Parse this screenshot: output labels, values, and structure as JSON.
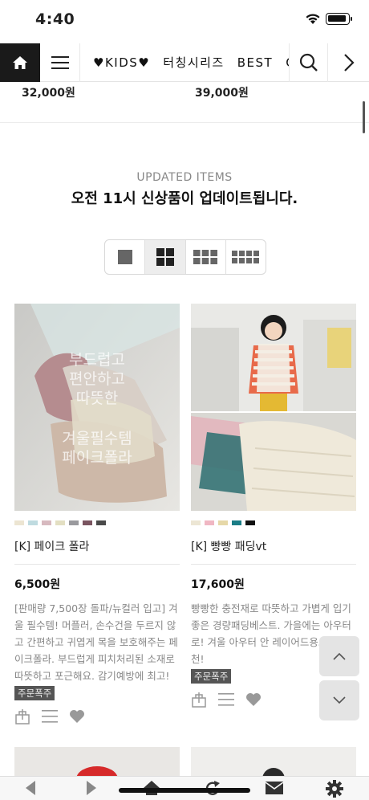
{
  "status": {
    "time": "4:40"
  },
  "nav": {
    "categories": [
      "♥KIDS♥",
      "터칭시리즈",
      "BEST",
      "C"
    ]
  },
  "top_prices": [
    "32,000원",
    "39,000원"
  ],
  "section": {
    "subtitle": "UPDATED ITEMS",
    "title": "오전 11시 신상품이 업데이트됩니다."
  },
  "products": [
    {
      "name": "[K] 페이크 폴라",
      "price": "6,500원",
      "description": "[판매량 7,500장 돌파/뉴컬러 입고] 겨울 필수템! 머플러, 손수건을 두르지 않고 간편하고 귀엽게 목을 보호해주는 페이크폴라. 부드럽게 피치처리된 소재로 따뜻하고 포근해요. 감기예방에 최고!",
      "tag": "주문폭주",
      "image_text": [
        "부드럽고",
        "편안하고",
        "따뜻한",
        "겨울필수템",
        "페이크폴라"
      ],
      "swatches": [
        "#ece5d2",
        "#bfdbe0",
        "#d7b9bf",
        "#e3dfc2",
        "#9a9a9e",
        "#7a5560",
        "#4a4a4a"
      ]
    },
    {
      "name": "[K] 빵빵 패딩vt",
      "price": "17,600원",
      "description": "빵빵한 충전재로 따뜻하고 가볍게 입기좋은 경량패딩베스트. 가을에는 아우터로! 겨울 아우터 안 레이어드용으로 추천!",
      "tag": "주문폭주",
      "swatches": [
        "#ece6d4",
        "#f0b7c3",
        "#e6d8a8",
        "#1a7d86",
        "#111111"
      ]
    }
  ],
  "colors": {
    "accent": "#1a1a1a",
    "tag_bg": "#555555",
    "muted_text": "#888888"
  }
}
